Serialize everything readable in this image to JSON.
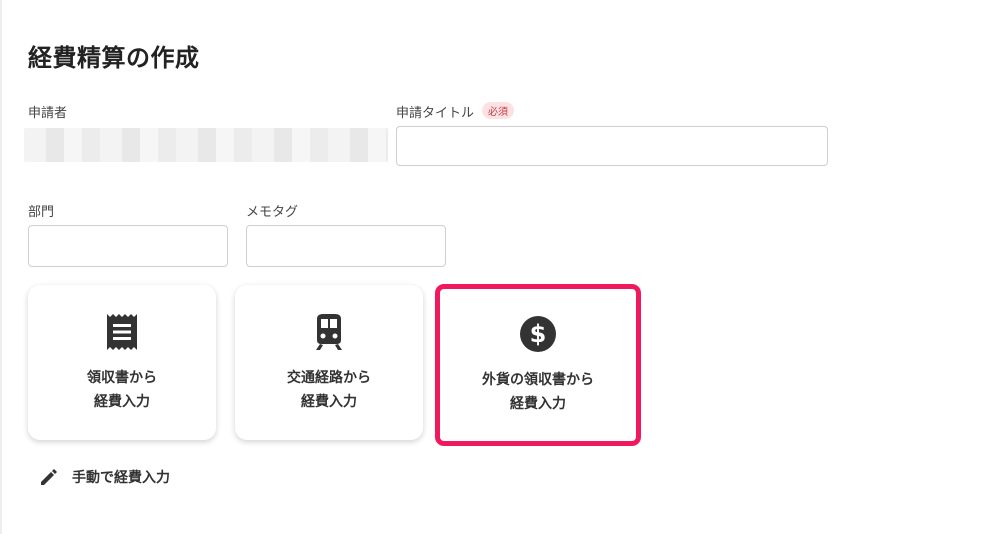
{
  "header": {
    "title": "経費精算の作成"
  },
  "form": {
    "applicant_label": "申請者",
    "request_title_label": "申請タイトル",
    "required_badge": "必須",
    "request_title_value": "",
    "department_label": "部門",
    "department_value": "",
    "memo_tag_label": "メモタグ",
    "memo_tag_value": ""
  },
  "cards": [
    {
      "line1": "領収書から",
      "line2": "経費入力",
      "icon": "receipt-icon"
    },
    {
      "line1": "交通経路から",
      "line2": "経費入力",
      "icon": "train-icon"
    },
    {
      "line1": "外貨の領収書から",
      "line2": "経費入力",
      "icon": "dollar-icon"
    }
  ],
  "manual_entry": {
    "label": "手動で経費入力",
    "icon": "pencil-icon"
  },
  "colors": {
    "highlight": "#f0195e",
    "required_badge_text": "#c73c46",
    "required_badge_bg": "#fde2e4"
  }
}
